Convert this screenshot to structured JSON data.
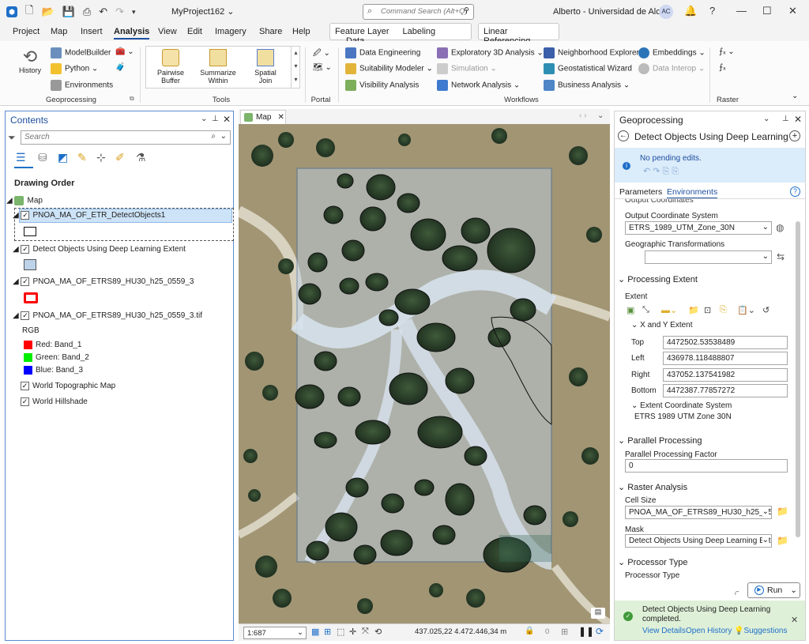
{
  "titlebar": {
    "project": "MyProject162 ⌄",
    "command_search_placeholder": "Command Search (Alt+Q)",
    "user": "Alberto - Universidad de Alcalá",
    "avatar": "AC",
    "help": "?"
  },
  "menu": {
    "tabs": [
      "Project",
      "Map",
      "Insert",
      "Analysis",
      "View",
      "Edit",
      "Imagery",
      "Share",
      "Help"
    ],
    "context_tabs": [
      "Feature Layer",
      "Labeling",
      "Data"
    ],
    "linear_ref": "Linear Referencing"
  },
  "ribbon": {
    "history": "History",
    "modelbuilder": "ModelBuilder",
    "python": "Python",
    "environments": "Environments",
    "geoprocessing_group": "Geoprocessing",
    "pairwise_buffer": [
      "Pairwise",
      "Buffer"
    ],
    "summarize_within": [
      "Summarize",
      "Within"
    ],
    "spatial_join": [
      "Spatial",
      "Join"
    ],
    "tools_group": "Tools",
    "portal_group": "Portal",
    "data_engineering": "Data Engineering",
    "suitability_modeler": "Suitability Modeler",
    "visibility_analysis": "Visibility Analysis",
    "exploratory_3d": "Exploratory 3D Analysis",
    "simulation": "Simulation",
    "network_analysis": "Network Analysis",
    "neighborhood_explorer": "Neighborhood Explorer",
    "geostatistical_wizard": "Geostatistical Wizard",
    "business_analysis": "Business Analysis",
    "embeddings": "Embeddings",
    "data_interop": "Data Interop",
    "workflows_group": "Workflows",
    "raster_group": "Raster"
  },
  "contents": {
    "title": "Contents",
    "search_placeholder": "Search",
    "drawing_order": "Drawing Order",
    "map_label": "Map",
    "layers": {
      "detect_objects": "PNOA_MA_OF_ETR_DetectObjects1",
      "extent": "Detect Objects Using Deep Learning Extent",
      "etrs_layer": "PNOA_MA_OF_ETRS89_HU30_h25_0559_3",
      "tif_layer": "PNOA_MA_OF_ETRS89_HU30_h25_0559_3.tif",
      "rgb": "RGB",
      "red": "Red:   Band_1",
      "green": "Green: Band_2",
      "blue": "Blue:  Band_3",
      "topo": "World Topographic Map",
      "hillshade": "World Hillshade"
    },
    "colors": {
      "red": "#ff0000",
      "green": "#00ee00",
      "blue": "#0000ff",
      "extent_fill": "#bcd3ea"
    }
  },
  "map": {
    "tab": "Map",
    "scale": "1:687",
    "coords": "437.025,22 4.472.446,34 m",
    "lock_count": "0"
  },
  "geoprocessing": {
    "title": "Geoprocessing",
    "tool": "Detect Objects Using Deep Learning",
    "pending": "No pending edits.",
    "tab_parameters": "Parameters",
    "tab_environments": "Environments",
    "output_cs_header": "Output Coordinates",
    "output_cs_label": "Output Coordinate System",
    "output_cs_value": "ETRS_1989_UTM_Zone_30N",
    "geo_transform_label": "Geographic Transformations",
    "processing_extent": "Processing Extent",
    "extent_label": "Extent",
    "xy_extent": "X and Y Extent",
    "top_label": "Top",
    "top_value": "4472502.53538489",
    "left_label": "Left",
    "left_value": "436978.118488807",
    "right_label": "Right",
    "right_value": "437052.137541982",
    "bottom_label": "Bottom",
    "bottom_value": "4472387.77857272",
    "extent_cs_label": "Extent Coordinate System",
    "extent_cs_value": "ETRS 1989 UTM Zone 30N",
    "parallel_processing": "Parallel Processing",
    "ppf_label": "Parallel Processing Factor",
    "ppf_value": "0",
    "raster_analysis": "Raster Analysis",
    "cell_size_label": "Cell Size",
    "cell_size_value": "PNOA_MA_OF_ETRS89_HU30_h25_0559_",
    "mask_label": "Mask",
    "mask_value": "Detect Objects Using Deep Learning Exte",
    "processor_type_header": "Processor Type",
    "processor_type_label": "Processor Type",
    "run": "Run",
    "completed_line1": "Detect Objects Using Deep Learning",
    "completed_line2": "completed.",
    "view_details": "View Details",
    "open_history": "Open History",
    "suggestions": "Suggestions"
  }
}
